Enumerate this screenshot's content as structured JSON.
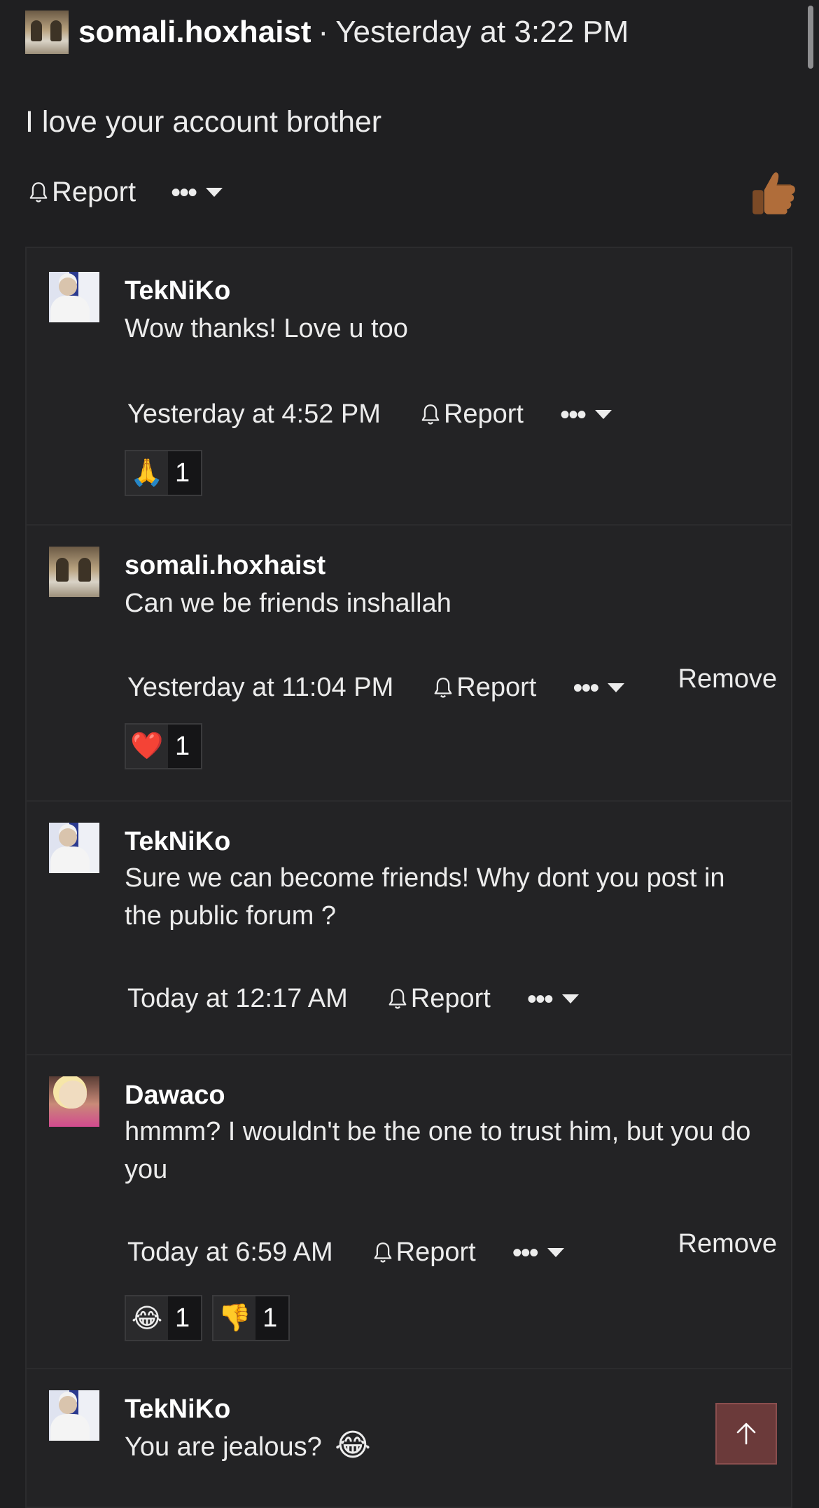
{
  "post": {
    "username": "somali.hoxhaist",
    "separator": "·",
    "time": "Yesterday at 3:22 PM",
    "body": "I love your account brother",
    "report_label": "Report",
    "more_label": "•••"
  },
  "comments": [
    {
      "author": "TekNiKo",
      "avatar": "teknico-avatar",
      "text": "Wow thanks! Love u too",
      "time": "Yesterday at 4:52 PM",
      "report_label": "Report",
      "more_label": "•••",
      "reactions": [
        {
          "emoji": "🙏",
          "count": "1"
        }
      ]
    },
    {
      "author": "somali.hoxhaist",
      "avatar": "somali-avatar",
      "text": "Can we be friends inshallah",
      "time": "Yesterday at 11:04 PM",
      "report_label": "Report",
      "more_label": "•••",
      "remove_label": "Remove",
      "reactions": [
        {
          "emoji": "❤️",
          "count": "1"
        }
      ]
    },
    {
      "author": "TekNiKo",
      "avatar": "teknico-avatar",
      "text": "Sure we can become friends! Why dont you post in the public forum ?",
      "time": "Today at 12:17 AM",
      "report_label": "Report",
      "more_label": "•••"
    },
    {
      "author": "Dawaco",
      "avatar": "dawaco-avatar",
      "text": "hmmm? I wouldn't be the one to trust him, but you do you",
      "time": "Today at 6:59 AM",
      "report_label": "Report",
      "more_label": "•••",
      "remove_label": "Remove",
      "reactions": [
        {
          "emoji": "😂",
          "count": "1"
        },
        {
          "emoji": "👎",
          "count": "1"
        }
      ]
    },
    {
      "author": "TekNiKo",
      "avatar": "teknico-avatar",
      "text": "You are jealous?",
      "emoji": "😂"
    }
  ],
  "icons": {
    "bell": "bell-icon",
    "like": "thumbs-up-icon",
    "scroll_top": "arrow-up-icon"
  },
  "colors": {
    "background": "#1f1f21",
    "panel": "#232325",
    "scroll_top_button": "#6b3a3a"
  }
}
